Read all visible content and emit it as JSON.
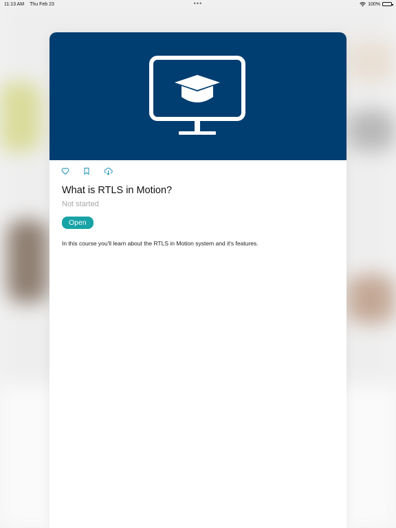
{
  "status_bar": {
    "time": "11:13 AM",
    "date": "Thu Feb 23",
    "battery": "100%",
    "battery_level": 1.0
  },
  "course": {
    "title": "What is RTLS in Motion?",
    "status": "Not started",
    "open_label": "Open",
    "description": "In this course you'll learn about the RTLS in Motion system and it's features."
  },
  "icons": {
    "hero": "monitor-graduation-cap-icon",
    "favorite": "heart-icon",
    "bookmark": "bookmark-icon",
    "download": "cloud-download-icon",
    "wifi": "wifi-icon",
    "battery": "battery-icon"
  },
  "colors": {
    "hero_background": "#003d70",
    "accent": "#18a3a6",
    "status_text_muted": "#a8a8a8"
  }
}
